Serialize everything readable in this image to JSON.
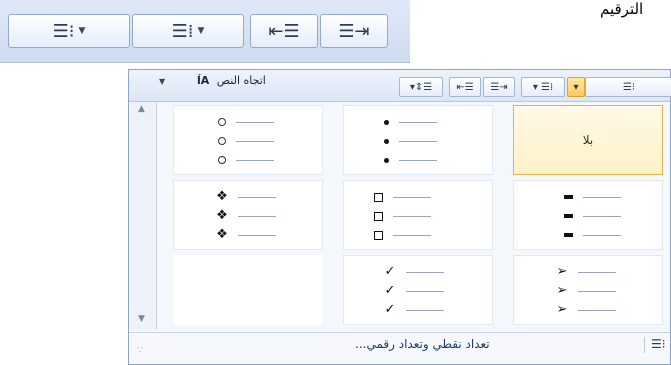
{
  "ribbon": {
    "title": "الترقيم",
    "buttons": [
      {
        "icon": "bullets-list-icon",
        "glyph": "☰⁝",
        "has_dropdown": true
      },
      {
        "icon": "numbering-list-icon",
        "glyph": "☰⁞",
        "has_dropdown": true
      },
      {
        "icon": "decrease-indent-icon",
        "glyph": "⇤☰",
        "has_dropdown": false
      },
      {
        "icon": "increase-indent-icon",
        "glyph": "☰⇥",
        "has_dropdown": false
      }
    ]
  },
  "panel": {
    "toolbar": {
      "text_direction_label": "اتجاه النص",
      "text_direction_icon": "ĺA"
    },
    "grid": [
      [
        {
          "type": "none",
          "label": "بلا",
          "selected": true
        },
        {
          "type": "dot",
          "selected": false
        },
        {
          "type": "ring",
          "selected": false
        }
      ],
      [
        {
          "type": "dash",
          "selected": false
        },
        {
          "type": "square",
          "selected": false
        },
        {
          "type": "diamond",
          "glyph": "❖",
          "selected": false
        }
      ],
      [
        {
          "type": "arrow",
          "glyph": "➢",
          "selected": false
        },
        {
          "type": "check",
          "glyph": "✓",
          "selected": false
        },
        {
          "type": "empty",
          "selected": false
        }
      ]
    ],
    "footer": {
      "link_text": "تعداد نقطي وتعداد رقمي...",
      "icon": "bullets-list-icon"
    }
  },
  "colors": {
    "selected_border": "#e2b44e",
    "selected_fill": "#fff1c9",
    "ribbon_bg": "#dfe9f7"
  }
}
